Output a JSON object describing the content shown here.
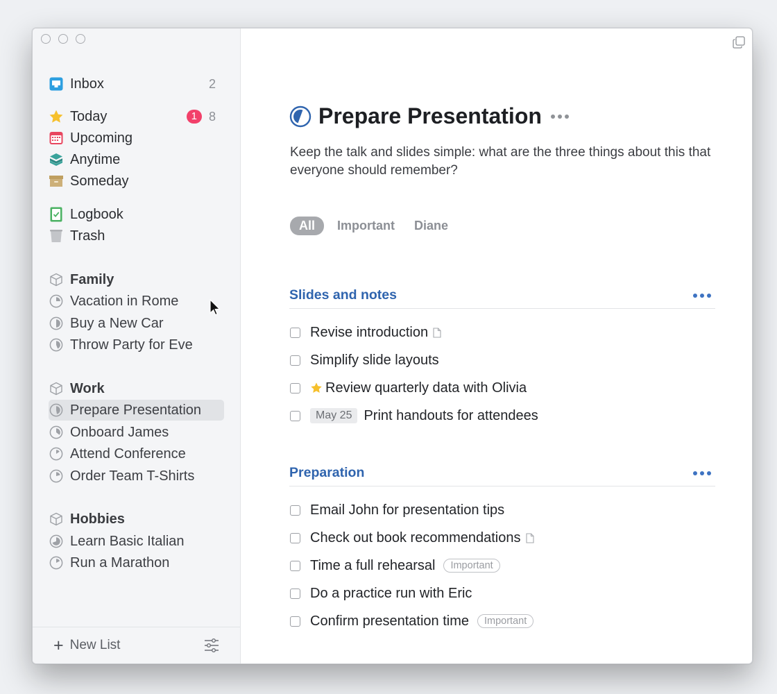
{
  "sidebar": {
    "inbox": {
      "label": "Inbox",
      "count": "2"
    },
    "today": {
      "label": "Today",
      "badge": "1",
      "count": "8"
    },
    "upcoming": {
      "label": "Upcoming"
    },
    "anytime": {
      "label": "Anytime"
    },
    "someday": {
      "label": "Someday"
    },
    "logbook": {
      "label": "Logbook"
    },
    "trash": {
      "label": "Trash"
    },
    "areas": [
      {
        "label": "Family",
        "projects": [
          "Vacation in Rome",
          "Buy a New Car",
          "Throw Party for Eve"
        ]
      },
      {
        "label": "Work",
        "projects": [
          "Prepare Presentation",
          "Onboard James",
          "Attend Conference",
          "Order Team T-Shirts"
        ]
      },
      {
        "label": "Hobbies",
        "projects": [
          "Learn Basic Italian",
          "Run a Marathon"
        ]
      }
    ],
    "selected_project": "Prepare Presentation",
    "footer": {
      "new_list_label": "New List"
    }
  },
  "project": {
    "title": "Prepare Presentation",
    "notes": "Keep the talk and slides simple: what are the three things about this that everyone should remember?",
    "tag_filters": [
      "All",
      "Important",
      "Diane"
    ],
    "active_filter": "All",
    "headings": [
      {
        "title": "Slides and notes",
        "todos": [
          {
            "text": "Revise introduction",
            "has_notes": true
          },
          {
            "text": "Simplify slide layouts"
          },
          {
            "text": "Review quarterly data with Olivia",
            "starred": true
          },
          {
            "text": "Print handouts for attendees",
            "date": "May 25"
          }
        ]
      },
      {
        "title": "Preparation",
        "todos": [
          {
            "text": "Email John for presentation tips"
          },
          {
            "text": "Check out book recommendations",
            "has_notes": true
          },
          {
            "text": "Time a full rehearsal",
            "tag": "Important"
          },
          {
            "text": "Do a practice run with Eric"
          },
          {
            "text": "Confirm presentation time",
            "tag": "Important"
          }
        ]
      }
    ]
  },
  "colors": {
    "accent_blue": "#2f64ae",
    "badge_red": "#f2406a",
    "today_star": "#f6c02c",
    "upcoming_red": "#e8465f",
    "anytime_teal": "#3aa39b",
    "someday_tan": "#cdb079",
    "logbook_green": "#4bb263"
  }
}
